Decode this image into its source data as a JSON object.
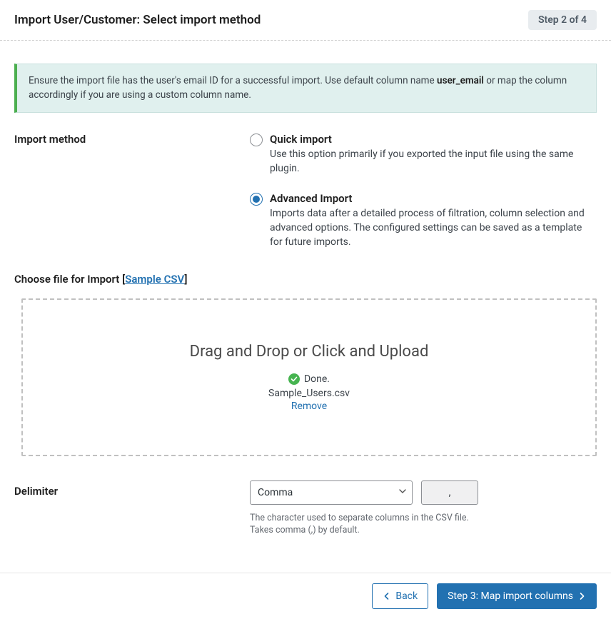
{
  "header": {
    "title": "Import User/Customer: Select import method",
    "step_badge": "Step 2 of 4"
  },
  "notice": {
    "pre": "Ensure the import file has the user's email ID for a successful import. Use default column name ",
    "bold": "user_email",
    "post": " or map the column accordingly if you are using a custom column name."
  },
  "import_method": {
    "label": "Import method",
    "quick": {
      "title": "Quick import",
      "desc": "Use this option primarily if you exported the input file using the same plugin.",
      "selected": false
    },
    "advanced": {
      "title": "Advanced Import",
      "desc": "Imports data after a detailed process of filtration, column selection and advanced options. The configured settings can be saved as a template for future imports.",
      "selected": true
    }
  },
  "choose_file": {
    "label_pre": "Choose file for Import [",
    "sample_link": "Sample CSV",
    "label_post": "]"
  },
  "dropzone": {
    "title": "Drag and Drop or Click and Upload",
    "done": "Done.",
    "filename": "Sample_Users.csv",
    "remove": "Remove"
  },
  "delimiter": {
    "label": "Delimiter",
    "selected": "Comma",
    "value": ",",
    "help1": "The character used to separate columns in the CSV file.",
    "help2": "Takes comma (,) by default."
  },
  "footer": {
    "back": "Back",
    "next": "Step 3: Map import columns"
  }
}
